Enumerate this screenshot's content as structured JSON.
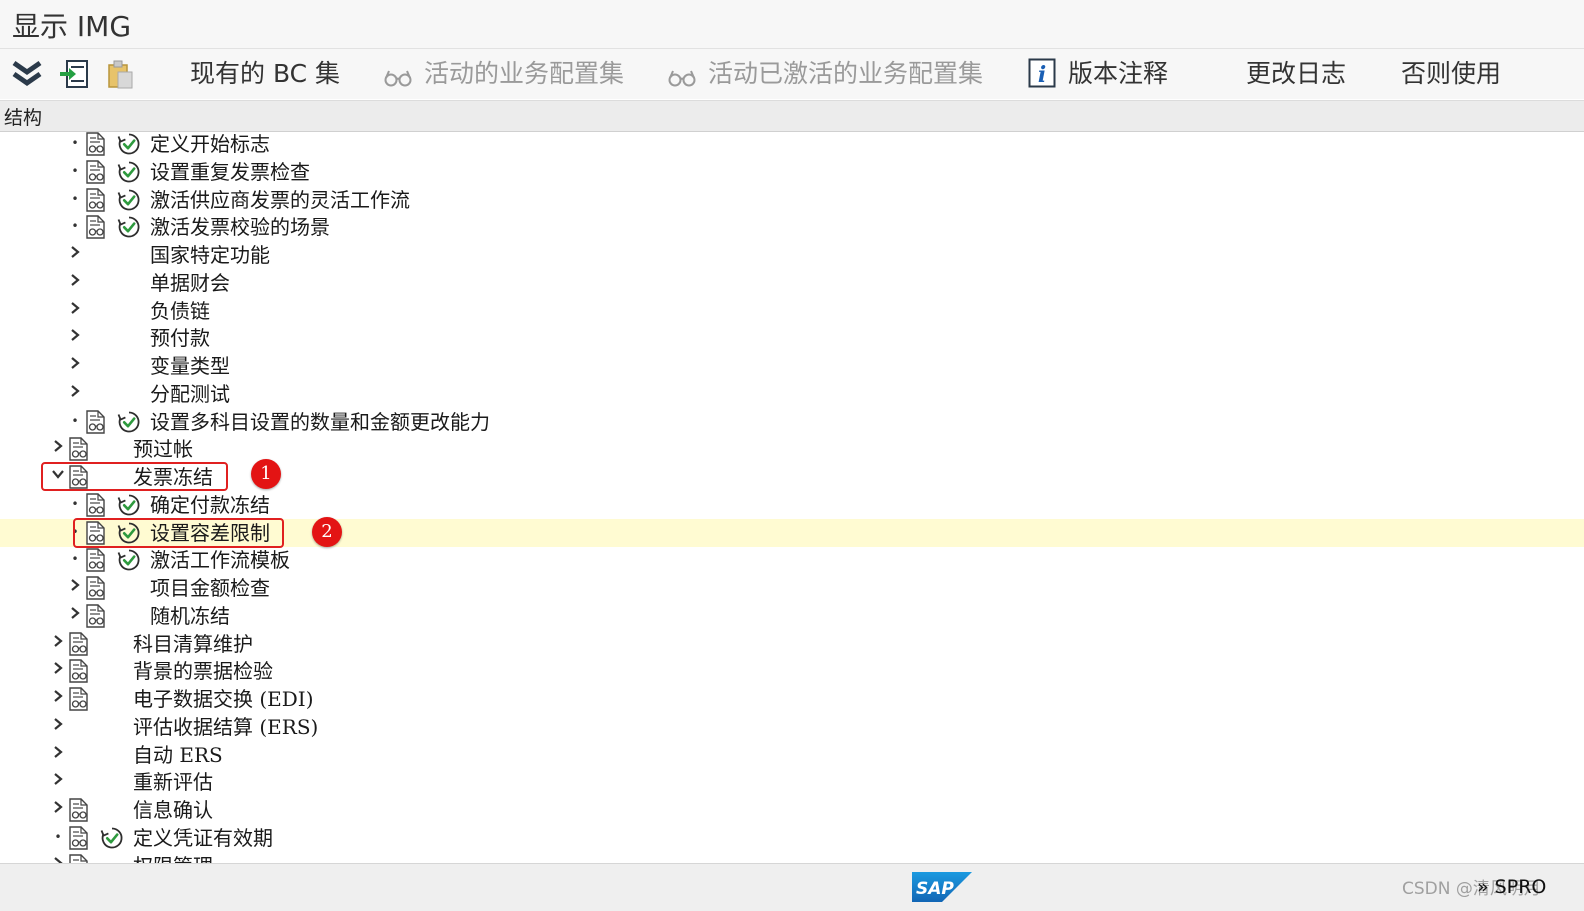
{
  "window": {
    "title": "显示 IMG"
  },
  "toolbar": {
    "bc_sets_label": "现有的 BC 集",
    "active_bc_sets_label": "活动的业务配置集",
    "activated_bc_sets_label": "活动已激活的业务配置集",
    "release_notes_label": "版本注释",
    "change_log_label": "更改日志",
    "otherwise_use_label": "否则使用"
  },
  "structure": {
    "header": "结构"
  },
  "tree": {
    "rows": [
      {
        "label": "定义开始标志"
      },
      {
        "label": "设置重复发票检查"
      },
      {
        "label": "激活供应商发票的灵活工作流"
      },
      {
        "label": "激活发票校验的场景"
      },
      {
        "label": "国家特定功能"
      },
      {
        "label": "单据财会"
      },
      {
        "label": "负债链"
      },
      {
        "label": "预付款"
      },
      {
        "label": "变量类型"
      },
      {
        "label": "分配测试"
      },
      {
        "label": "设置多科目设置的数量和金额更改能力"
      },
      {
        "label": "预过帐"
      },
      {
        "label": "发票冻结"
      },
      {
        "label": "确定付款冻结"
      },
      {
        "label": "设置容差限制"
      },
      {
        "label": "激活工作流模板"
      },
      {
        "label": "项目金额检查"
      },
      {
        "label": "随机冻结"
      },
      {
        "label": "科目清算维护"
      },
      {
        "label": "背景的票据检验"
      },
      {
        "label": "电子数据交换 (EDI)"
      },
      {
        "label": "评估收据结算 (ERS)"
      },
      {
        "label": "自动 ERS"
      },
      {
        "label": "重新评估"
      },
      {
        "label": "信息确认"
      },
      {
        "label": "定义凭证有效期"
      },
      {
        "label": "权限管理"
      }
    ]
  },
  "annotations": {
    "badge_1": "1",
    "badge_2": "2"
  },
  "status": {
    "logo_text": "SAP",
    "watermark": "CSDN @清风明月",
    "transaction": "SPRO",
    "more_glyph": "»"
  },
  "colors": {
    "selected_row": "#fffbd2",
    "highlight_red": "#e02020",
    "sap_blue": "#1a73c8",
    "activity_green": "#2e9a3e"
  }
}
